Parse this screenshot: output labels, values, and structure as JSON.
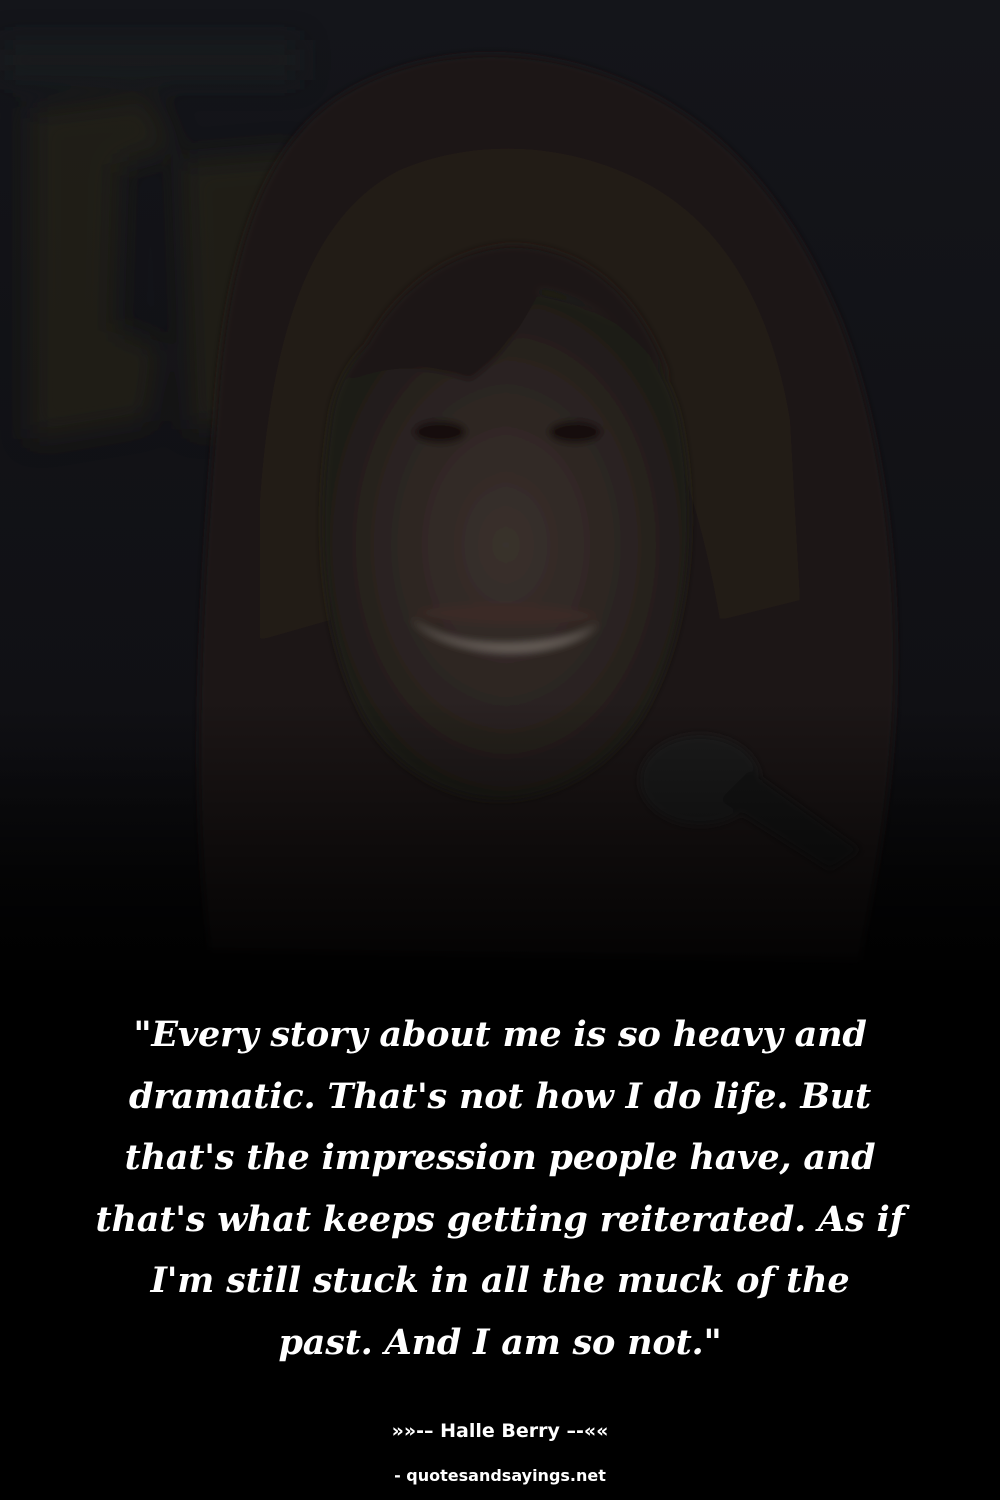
{
  "quote": {
    "lines": [
      "\"Every story about me is so heavy and",
      "dramatic. That's not how I do life. But",
      "that's the impression people have, and",
      "that's what keeps getting reiterated. As if",
      "I'm still stuck in all the muck of the",
      "past. And I am so not.\""
    ]
  },
  "author": {
    "text": "»»-– Halle Berry –-««"
  },
  "source": {
    "text": "- quotesandsayings.net"
  },
  "colors": {
    "background": "#000000",
    "text": "#ffffff"
  }
}
